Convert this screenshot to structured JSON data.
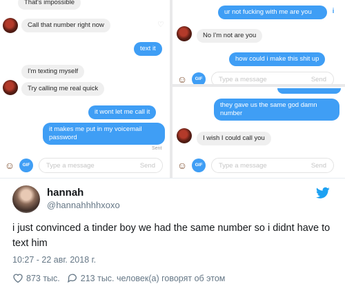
{
  "left_panel": {
    "messages": [
      {
        "dir": "in",
        "text": "That's impossible"
      },
      {
        "dir": "in",
        "text": "Call that number right now"
      },
      {
        "dir": "out",
        "text": "text it"
      },
      {
        "dir": "in",
        "text": "I'm texting myself"
      },
      {
        "dir": "in",
        "text": "Try calling me real quick"
      },
      {
        "dir": "out",
        "text": "it wont let me call it"
      },
      {
        "dir": "out",
        "text": "it makes me put in my voicemail password"
      }
    ],
    "sent_label": "Sent",
    "input": {
      "placeholder": "Type a message",
      "send": "Send",
      "gif": "GIF"
    }
  },
  "right_top_panel": {
    "messages": [
      {
        "dir": "out",
        "text": "ur not fucking with me are you"
      },
      {
        "dir": "in",
        "text": "No I'm not are you"
      },
      {
        "dir": "out",
        "text": "how could i make this shit up"
      }
    ],
    "input": {
      "placeholder": "Type a message",
      "send": "Send",
      "gif": "GIF"
    }
  },
  "right_bottom_panel": {
    "messages": [
      {
        "dir": "out",
        "text": "they gave us the same god damn number"
      },
      {
        "dir": "in",
        "text": "I wish I could call you"
      }
    ],
    "input": {
      "placeholder": "Type a message",
      "send": "Send",
      "gif": "GIF"
    }
  },
  "tweet": {
    "name": "hannah",
    "handle": "@hannahhhhxoxo",
    "text": "i just convinced a tinder boy we had the same number so i didnt have to text him",
    "timestamp": "10:27 - 22 авг. 2018 г.",
    "likes": "873 тыс.",
    "replies": "213 тыс. человек(а) говорят об этом",
    "bird_color": "#1da1f2"
  },
  "colors": {
    "outgoing_bubble": "#3f9ef5",
    "incoming_bubble": "#efefef"
  },
  "icons": [
    "heart-icon",
    "info-icon",
    "gif-icon",
    "face-icon",
    "twitter-bird-icon",
    "reply-bubble-icon"
  ]
}
